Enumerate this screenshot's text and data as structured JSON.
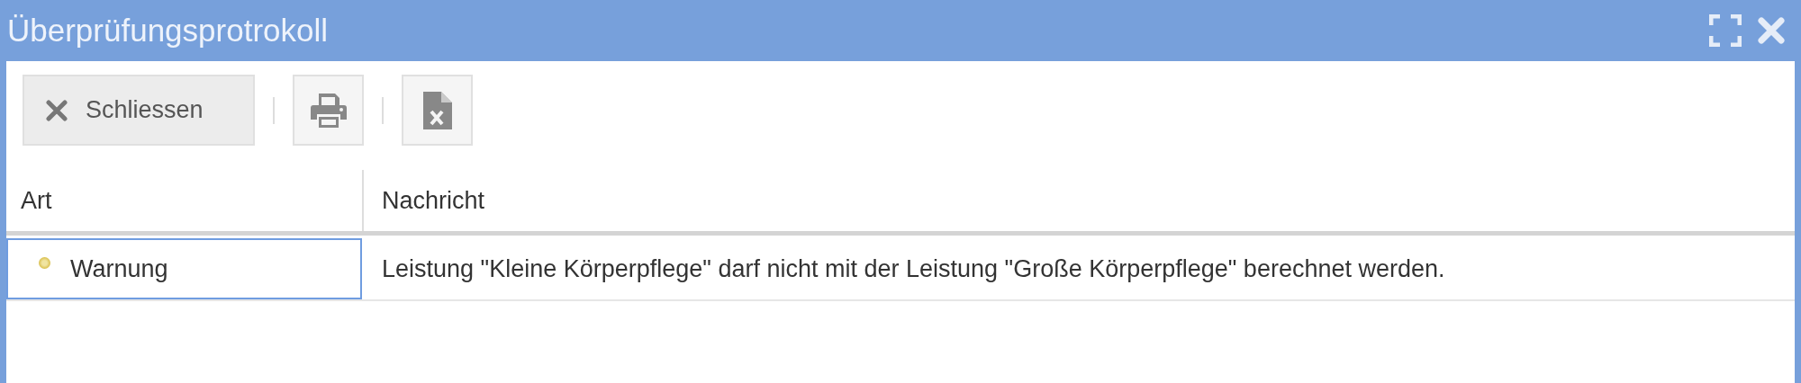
{
  "window": {
    "title": "Überprüfungsprotrokoll"
  },
  "toolbar": [
    {
      "kind": "close",
      "label": "Schliessen"
    },
    {
      "kind": "print"
    },
    {
      "kind": "excel"
    }
  ],
  "table": {
    "columns": [
      "Art",
      "Nachricht"
    ],
    "rows": [
      {
        "selected": true,
        "type": "Warnung",
        "message": "Leistung \"Kleine Körperpflege\" darf nicht mit der Leistung \"Große Körperpflege\" berechnet werden."
      }
    ]
  }
}
